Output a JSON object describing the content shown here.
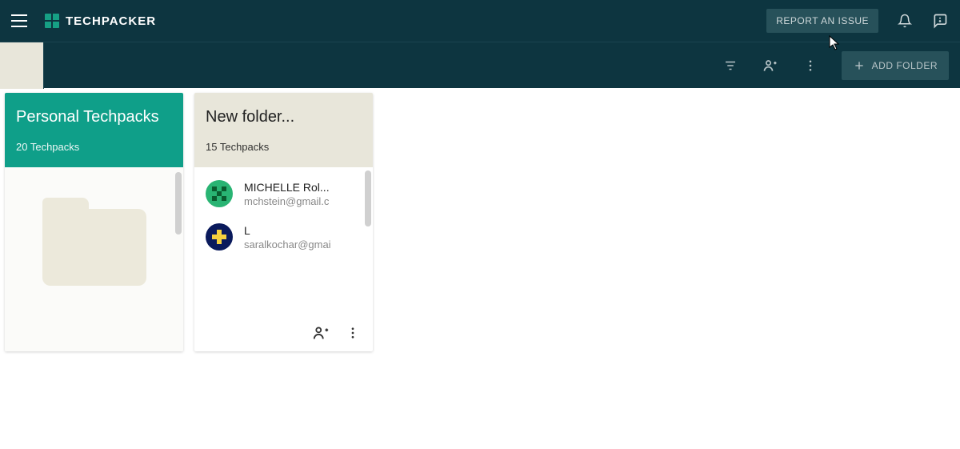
{
  "brand": {
    "name": "TECHPACKER"
  },
  "topbar": {
    "report_label": "REPORT AN ISSUE"
  },
  "subbar": {
    "add_folder_label": "ADD FOLDER"
  },
  "folders": [
    {
      "title": "Personal Techpacks",
      "subtitle": "20 Techpacks"
    },
    {
      "title": "New folder...",
      "subtitle": "15 Techpacks",
      "members": [
        {
          "name": "MICHELLE Rol...",
          "email": "mchstein@gmail.c"
        },
        {
          "name": "L",
          "email": "saralkochar@gmai"
        }
      ]
    }
  ]
}
